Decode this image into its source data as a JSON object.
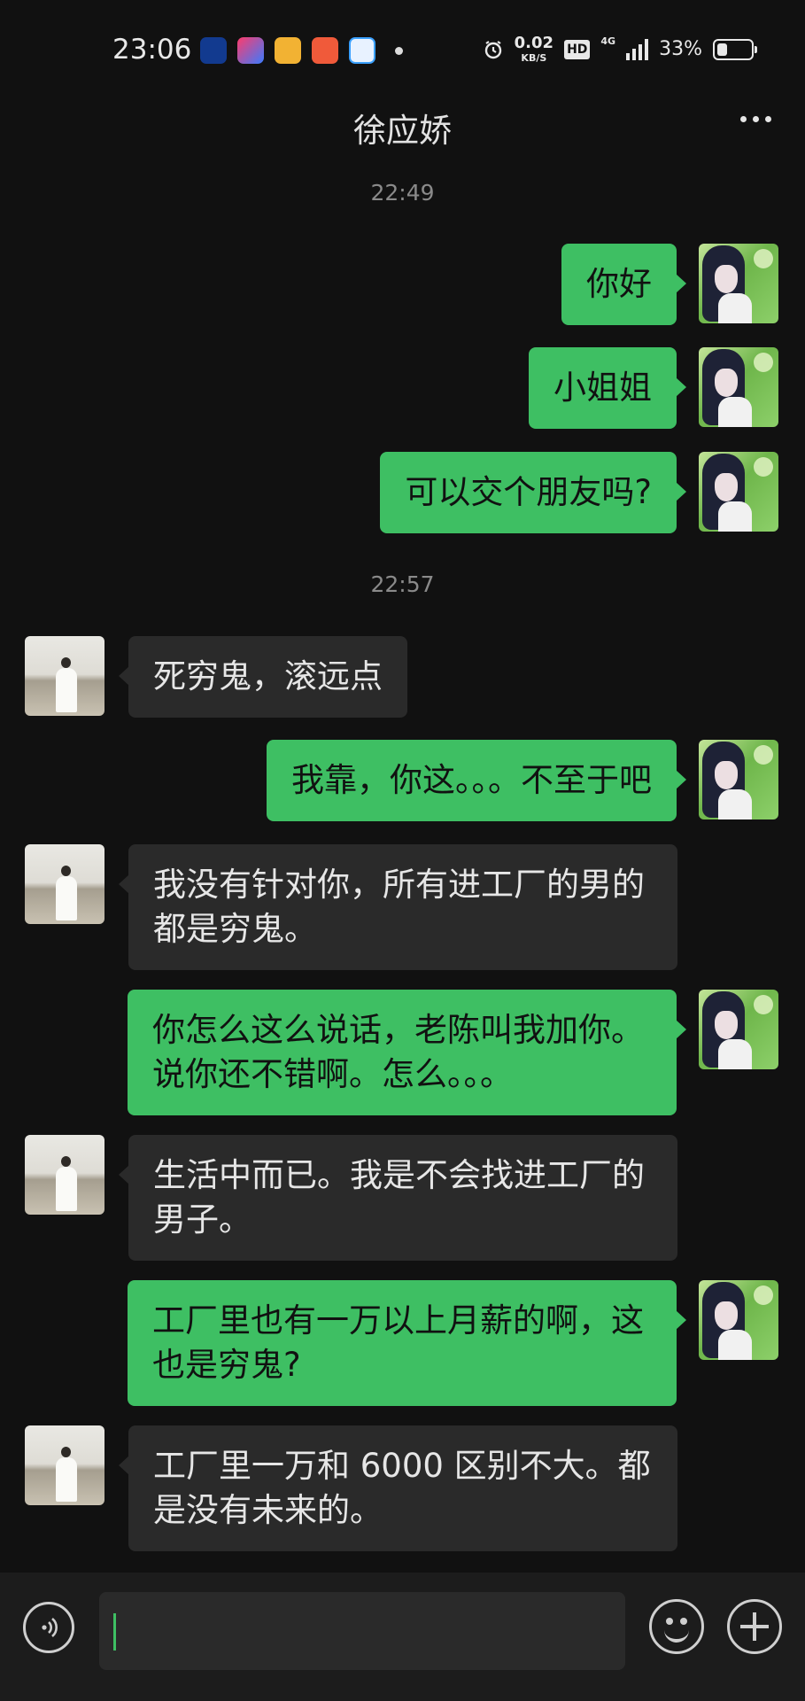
{
  "status_bar": {
    "time": "23:06",
    "net_speed": "0.02",
    "net_unit": "KB/S",
    "hd_label": "HD",
    "signal_label": "4G",
    "battery_percent": "33%",
    "battery_level": 0.33,
    "app_icons": [
      "12123-app-icon",
      "video-app-icon",
      "weibo-icon",
      "fanqie-app-icon",
      "browser-app-icon"
    ]
  },
  "header": {
    "title": "徐应娇",
    "more_icon": "more-dots-icon"
  },
  "chat": {
    "timestamps": [
      "22:49",
      "22:57"
    ],
    "messages": [
      {
        "sender": "me",
        "text": "你好"
      },
      {
        "sender": "me",
        "text": "小姐姐"
      },
      {
        "sender": "me",
        "text": "可以交个朋友吗?"
      },
      {
        "sender": "them",
        "text": "死穷鬼，滚远点"
      },
      {
        "sender": "me",
        "text": "我靠，你这。。。不至于吧"
      },
      {
        "sender": "them",
        "text": "我没有针对你，所有进工厂的男的都是穷鬼。"
      },
      {
        "sender": "me",
        "text": "你怎么这么说话，老陈叫我加你。说你还不错啊。怎么。。。"
      },
      {
        "sender": "them",
        "text": "生活中而已。我是不会找进工厂的男子。"
      },
      {
        "sender": "me",
        "text": "工厂里也有一万以上月薪的啊，这也是穷鬼?"
      },
      {
        "sender": "them",
        "text": "工厂里一万和 6000 区别不大。都是没有未来的。"
      }
    ]
  },
  "input_bar": {
    "voice_icon": "voice-icon",
    "emoji_icon": "emoji-icon",
    "plus_icon": "plus-icon",
    "text_value": ""
  },
  "colors": {
    "background": "#111111",
    "my_bubble": "#3ebf63",
    "their_bubble": "#2a2a2a",
    "text_light": "#e6e6e6"
  }
}
